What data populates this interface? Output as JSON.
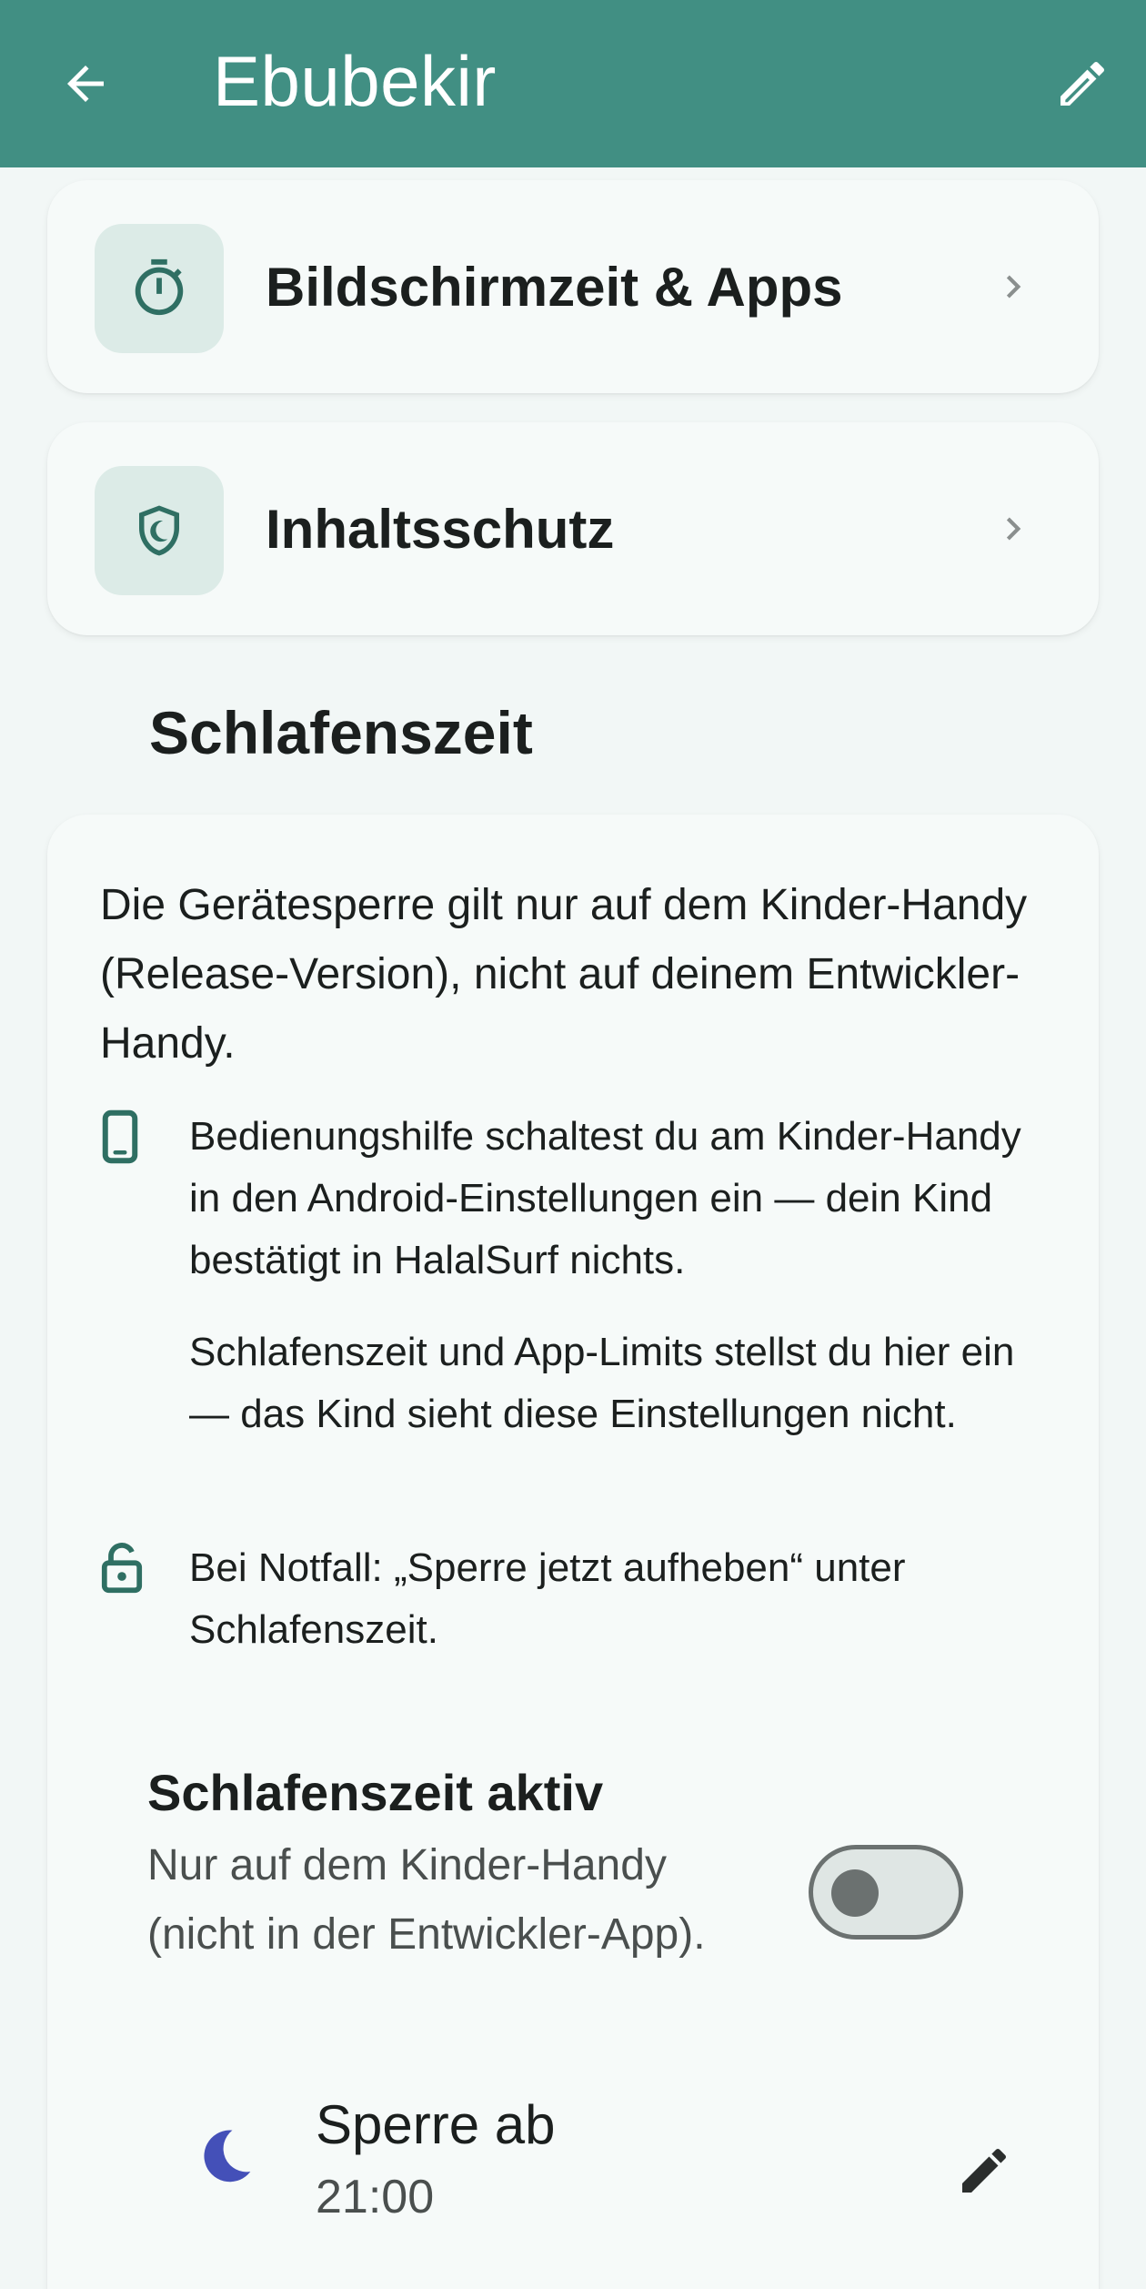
{
  "appbar": {
    "title": "Ebubekir",
    "back_icon": "arrow-back-icon",
    "edit_icon": "pencil-icon",
    "background": "#418f83"
  },
  "nav_cards": [
    {
      "label": "Bildschirmzeit & Apps",
      "icon": "timer-icon"
    },
    {
      "label": "Inhaltsschutz",
      "icon": "shield-moon-icon"
    }
  ],
  "bedtime_section": {
    "title": "Schlafenszeit",
    "icon": "moon-icon",
    "intro": "Die Gerätesperre gilt nur auf dem Kinder-Handy (Release-Version), nicht auf deinem Entwickler-Handy.",
    "bullets": [
      {
        "icon": "phone-icon",
        "text": "Bedienungshilfe schaltest du am Kinder-Handy in den Android-Einstellungen ein — dein Kind bestätigt in HalalSurf nichts."
      },
      {
        "icon": "moon-icon",
        "text": "Schlafenszeit und App-Limits stellst du hier ein — das Kind sieht diese Einstellungen nicht."
      },
      {
        "icon": "unlock-icon",
        "text": "Bei Notfall: „Sperre jetzt aufheben“ unter Schlafenszeit."
      }
    ],
    "toggle": {
      "title": "Schlafenszeit aktiv",
      "subtitle": "Nur auf dem Kinder-Handy (nicht in der Entwickler-App).",
      "enabled": false
    },
    "lock_row": {
      "title": "Sperre ab",
      "value": "21:00",
      "icon": "moon-icon",
      "icon_color": "#4450b8"
    }
  },
  "colors": {
    "accent": "#2f6f63",
    "tile": "#dcebe7"
  }
}
